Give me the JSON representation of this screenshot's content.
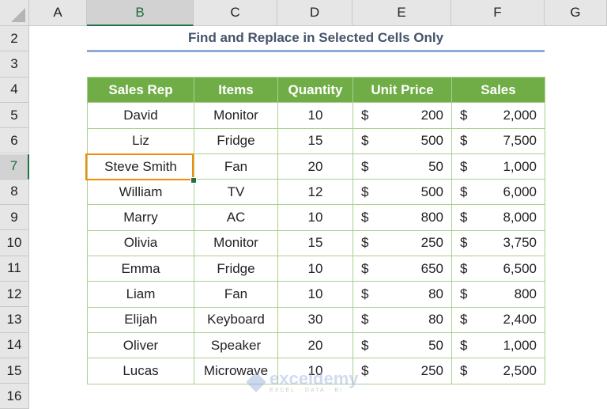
{
  "sheet": {
    "columns": [
      "A",
      "B",
      "C",
      "D",
      "E",
      "F",
      "G"
    ],
    "selected_column": "B",
    "rows": [
      "2",
      "3",
      "4",
      "5",
      "6",
      "7",
      "8",
      "9",
      "10",
      "11",
      "12",
      "13",
      "14",
      "15",
      "16"
    ],
    "selected_row": "7"
  },
  "title": "Find and Replace in Selected Cells Only",
  "table": {
    "headers": [
      "Sales Rep",
      "Items",
      "Quantity",
      "Unit Price",
      "Sales"
    ],
    "currency_symbol": "$",
    "rows": [
      {
        "rep": "David",
        "item": "Monitor",
        "qty": "10",
        "price": "200",
        "sales": "2,000"
      },
      {
        "rep": "Liz",
        "item": "Fridge",
        "qty": "15",
        "price": "500",
        "sales": "7,500"
      },
      {
        "rep": "Steve Smith",
        "item": "Fan",
        "qty": "20",
        "price": "50",
        "sales": "1,000"
      },
      {
        "rep": "William",
        "item": "TV",
        "qty": "12",
        "price": "500",
        "sales": "6,000"
      },
      {
        "rep": "Marry",
        "item": "AC",
        "qty": "10",
        "price": "800",
        "sales": "8,000"
      },
      {
        "rep": "Olivia",
        "item": "Monitor",
        "qty": "15",
        "price": "250",
        "sales": "3,750"
      },
      {
        "rep": "Emma",
        "item": "Fridge",
        "qty": "10",
        "price": "650",
        "sales": "6,500"
      },
      {
        "rep": "Liam",
        "item": "Fan",
        "qty": "10",
        "price": "80",
        "sales": "800"
      },
      {
        "rep": "Elijah",
        "item": "Keyboard",
        "qty": "30",
        "price": "80",
        "sales": "2,400"
      },
      {
        "rep": "Oliver",
        "item": "Speaker",
        "qty": "20",
        "price": "50",
        "sales": "1,000"
      },
      {
        "rep": "Lucas",
        "item": "Microwave",
        "qty": "10",
        "price": "250",
        "sales": "2,500"
      }
    ]
  },
  "selected_cell": "B7",
  "watermark": {
    "brand": "exceldemy",
    "tagline": "EXCEL · DATA · BI"
  },
  "colors": {
    "header_green": "#70ad47",
    "border_green": "#a9d08e",
    "selection_orange": "#f58a07",
    "title_color": "#44546a",
    "title_underline": "#8ea9db"
  }
}
